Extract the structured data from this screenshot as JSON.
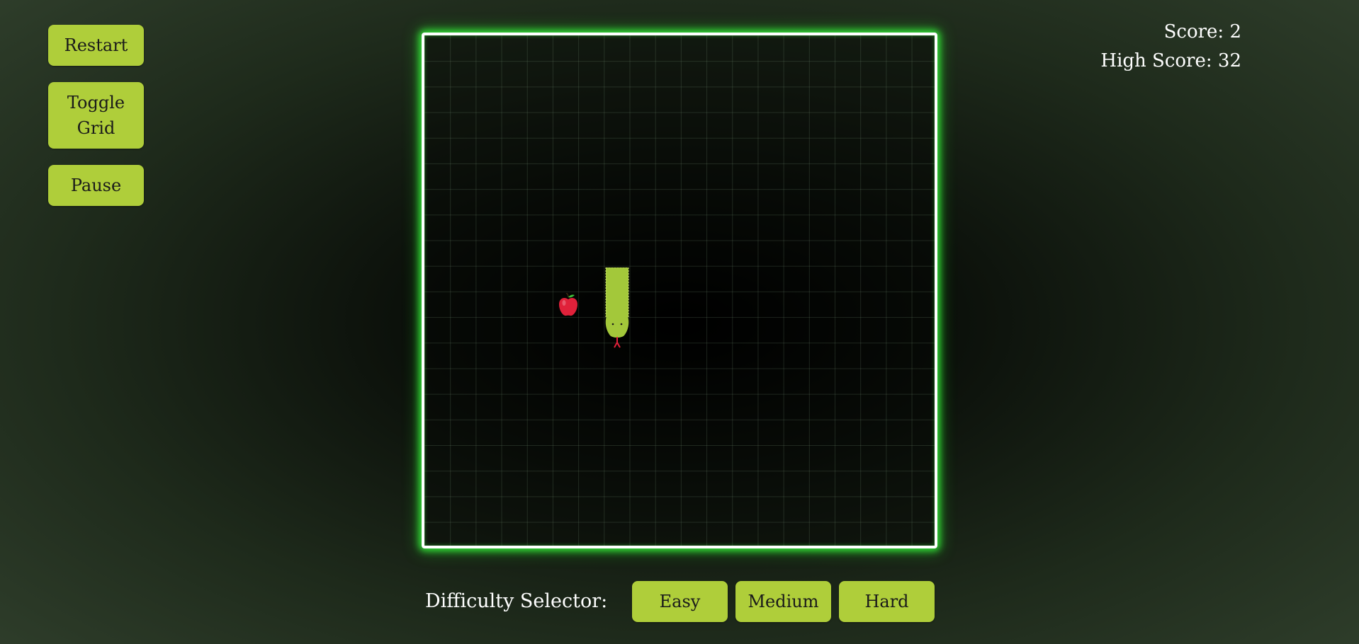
{
  "controls": {
    "restart_label": "Restart",
    "toggle_grid_label": "Toggle Grid",
    "pause_label": "Pause"
  },
  "scoreboard": {
    "score_label": "Score:",
    "score_value": "2",
    "high_score_label": "High Score:",
    "high_score_value": "32"
  },
  "difficulty": {
    "label": "Difficulty Selector:",
    "options": [
      "Easy",
      "Medium",
      "Hard"
    ]
  },
  "colors": {
    "button_bg": "#afce3a",
    "board_glow": "#35e83a",
    "snake": "#a3c83a",
    "apple": "#e0213a"
  },
  "board": {
    "grid_visible": true
  },
  "icons": {
    "food": "apple-icon",
    "player": "snake"
  }
}
